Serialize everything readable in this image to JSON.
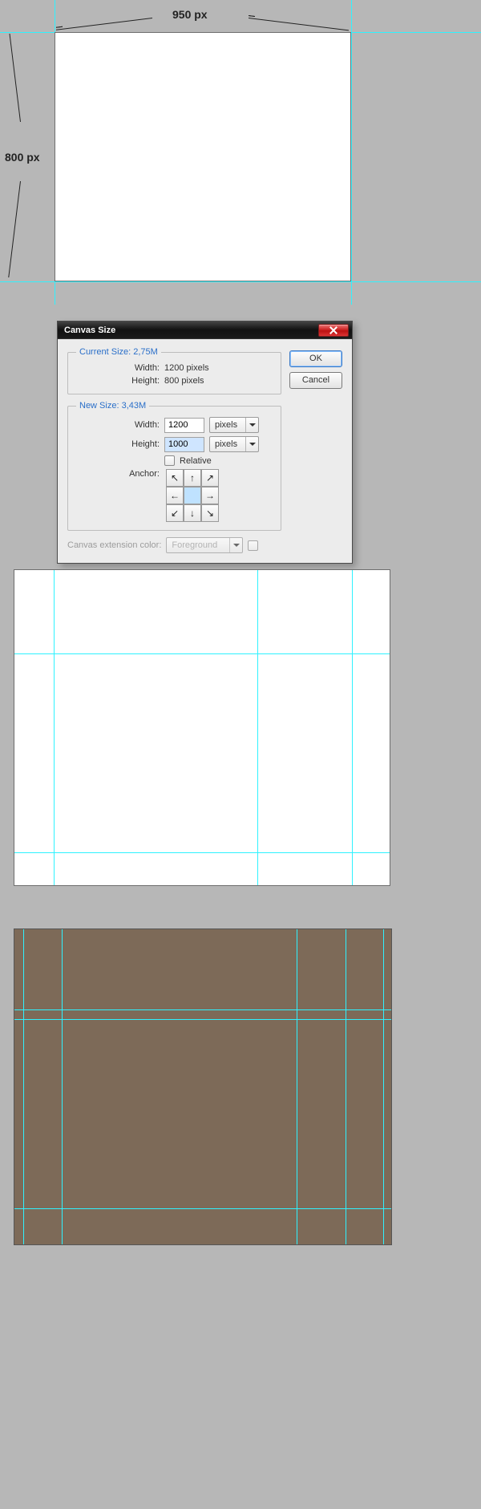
{
  "diagram": {
    "width_label": "950 px",
    "height_label": "800 px"
  },
  "dialog": {
    "title": "Canvas Size",
    "ok": "OK",
    "cancel": "Cancel",
    "current": {
      "legend": "Current Size: 2,75M",
      "width_label": "Width:",
      "width_value": "1200 pixels",
      "height_label": "Height:",
      "height_value": "800 pixels"
    },
    "new": {
      "legend": "New Size: 3,43M",
      "width_label": "Width:",
      "width_value": "1200",
      "width_unit": "pixels",
      "height_label": "Height:",
      "height_value": "1000",
      "height_unit": "pixels",
      "relative_label": "Relative",
      "anchor_label": "Anchor:"
    },
    "extension": {
      "label": "Canvas extension color:",
      "value": "Foreground"
    },
    "anchor_arrows": {
      "nw": "↖",
      "n": "↑",
      "ne": "↗",
      "w": "←",
      "e": "→",
      "sw": "↙",
      "s": "↓",
      "se": "↘"
    }
  }
}
